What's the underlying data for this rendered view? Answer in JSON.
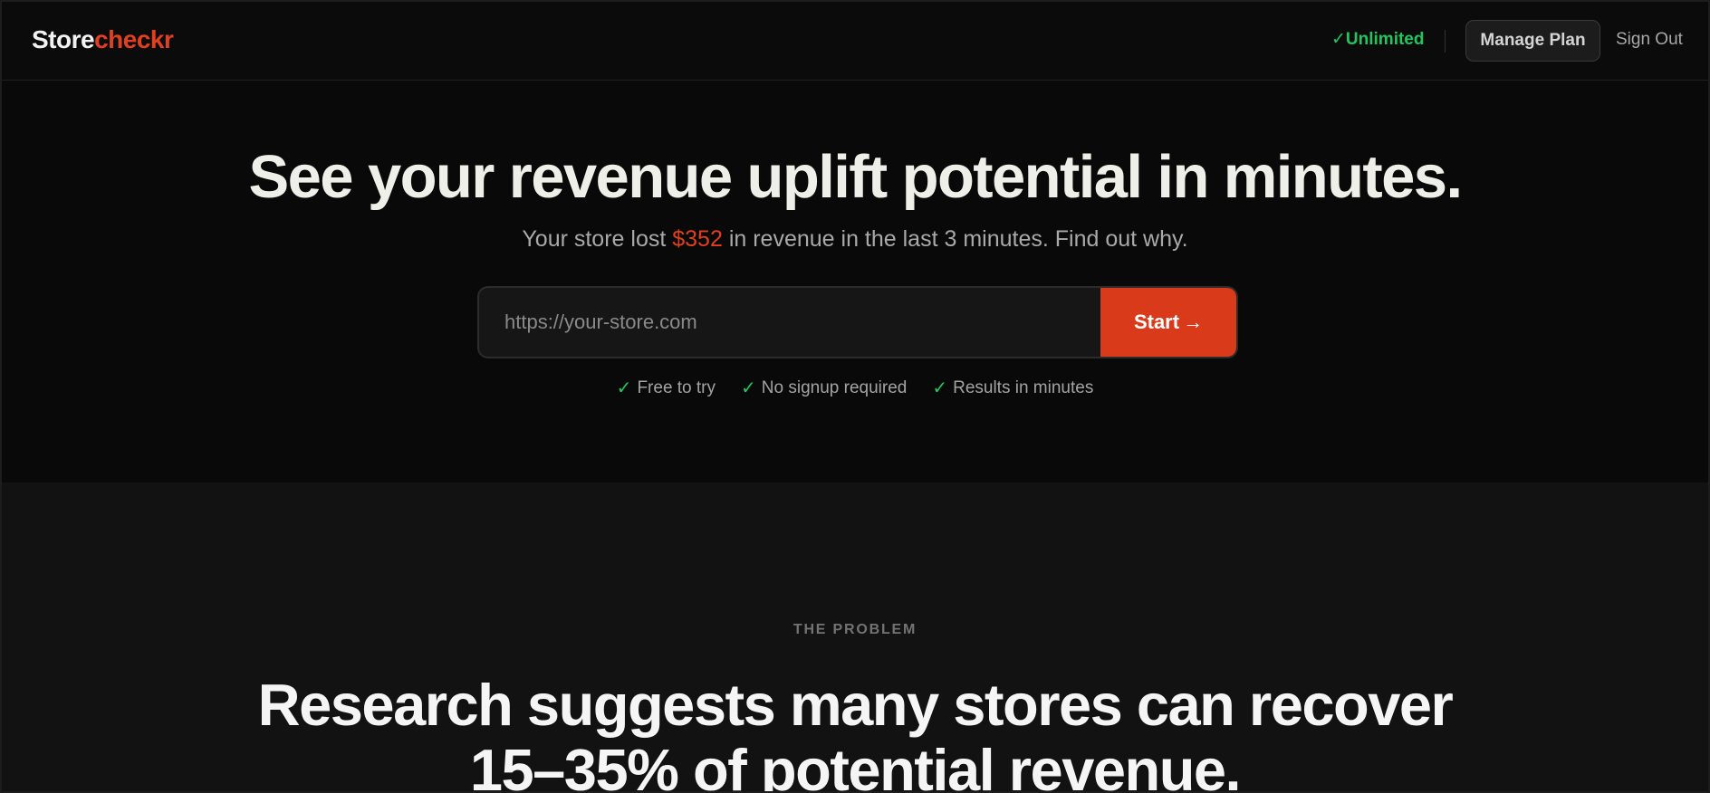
{
  "nav": {
    "logo_part1": "Store",
    "logo_part2": "checkr",
    "plan_check": "✓",
    "plan_label": "Unlimited",
    "manage_label": "Manage Plan",
    "signout_label": "Sign Out"
  },
  "hero": {
    "title": "See your revenue uplift potential in minutes.",
    "sub_before": "Your store lost ",
    "sub_amount": "$352",
    "sub_after": " in revenue in the last 3 minutes. Find out why.",
    "url_placeholder": "https://your-store.com",
    "url_value": "",
    "start_label": "Start",
    "start_arrow": "→",
    "perks": [
      {
        "check": "✓",
        "label": "Free to try"
      },
      {
        "check": "✓",
        "label": "No signup required"
      },
      {
        "check": "✓",
        "label": "Results in minutes"
      }
    ]
  },
  "problem": {
    "eyebrow": "THE PROBLEM",
    "title_line1": "Research suggests many stores can recover",
    "title_line2": "15–35% of potential revenue."
  },
  "colors": {
    "accent": "#d93a1a",
    "brand_orange": "#e0401f",
    "success_green": "#22c55e",
    "background": "#0a0a0a"
  }
}
